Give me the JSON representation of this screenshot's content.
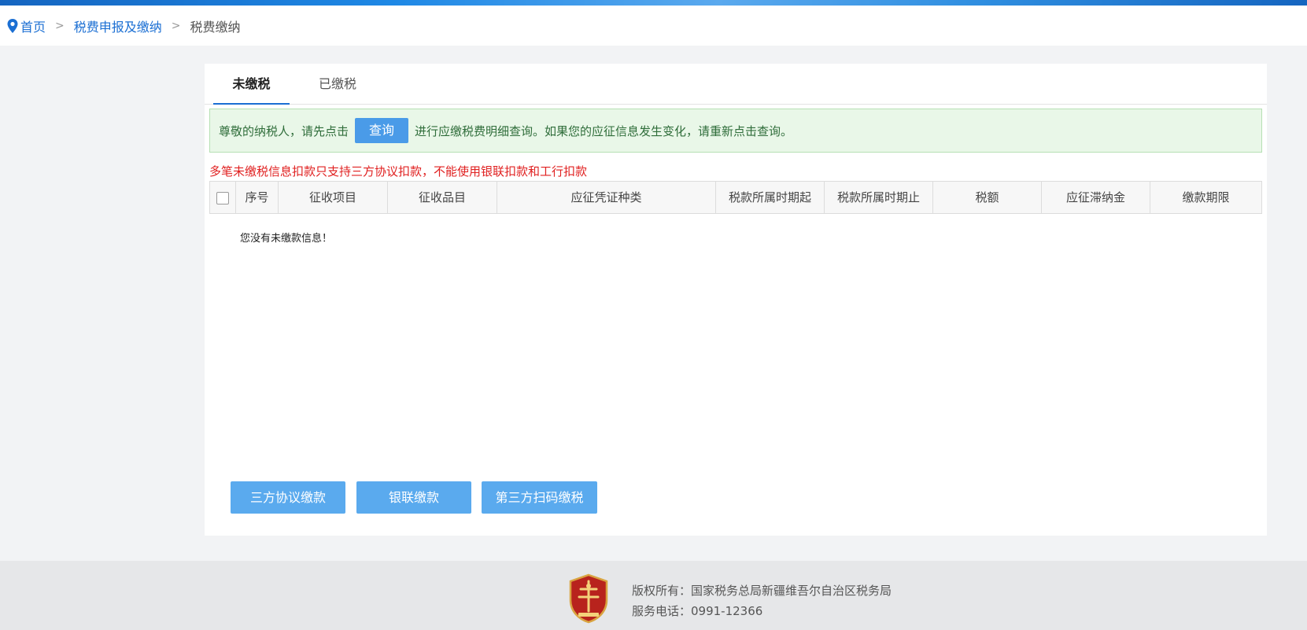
{
  "breadcrumb": {
    "home": "首页",
    "parent": "税费申报及缴纳",
    "current": "税费缴纳",
    "sep": ">"
  },
  "tabs": [
    {
      "label": "未缴税",
      "active": true
    },
    {
      "label": "已缴税",
      "active": false
    }
  ],
  "notice": {
    "prefix": "尊敬的纳税人，请先点击",
    "button": "查询",
    "suffix": "进行应缴税费明细查询。如果您的应征信息发生变化，请重新点击查询。"
  },
  "warning": "多笔未缴税信息扣款只支持三方协议扣款，不能使用银联扣款和工行扣款",
  "table": {
    "columns": [
      "序号",
      "征收项目",
      "征收品目",
      "应征凭证种类",
      "税款所属时期起",
      "税款所属时期止",
      "税额",
      "应征滞纳金",
      "缴款期限"
    ],
    "empty_message": "您没有未缴款信息！"
  },
  "actions": [
    "三方协议缴款",
    "银联缴款",
    "第三方扫码缴税"
  ],
  "footer": {
    "copyright": "版权所有：国家税务总局新疆维吾尔自治区税务局",
    "phone": "服务电话：0991-12366"
  },
  "colors": {
    "accent": "#1b6fd3",
    "button": "#5aaaee",
    "notice_bg": "#e9f7e8",
    "warning": "#e02020"
  },
  "icons": {
    "location": "location-pin-icon",
    "footer_logo": "tax-emblem-icon"
  }
}
